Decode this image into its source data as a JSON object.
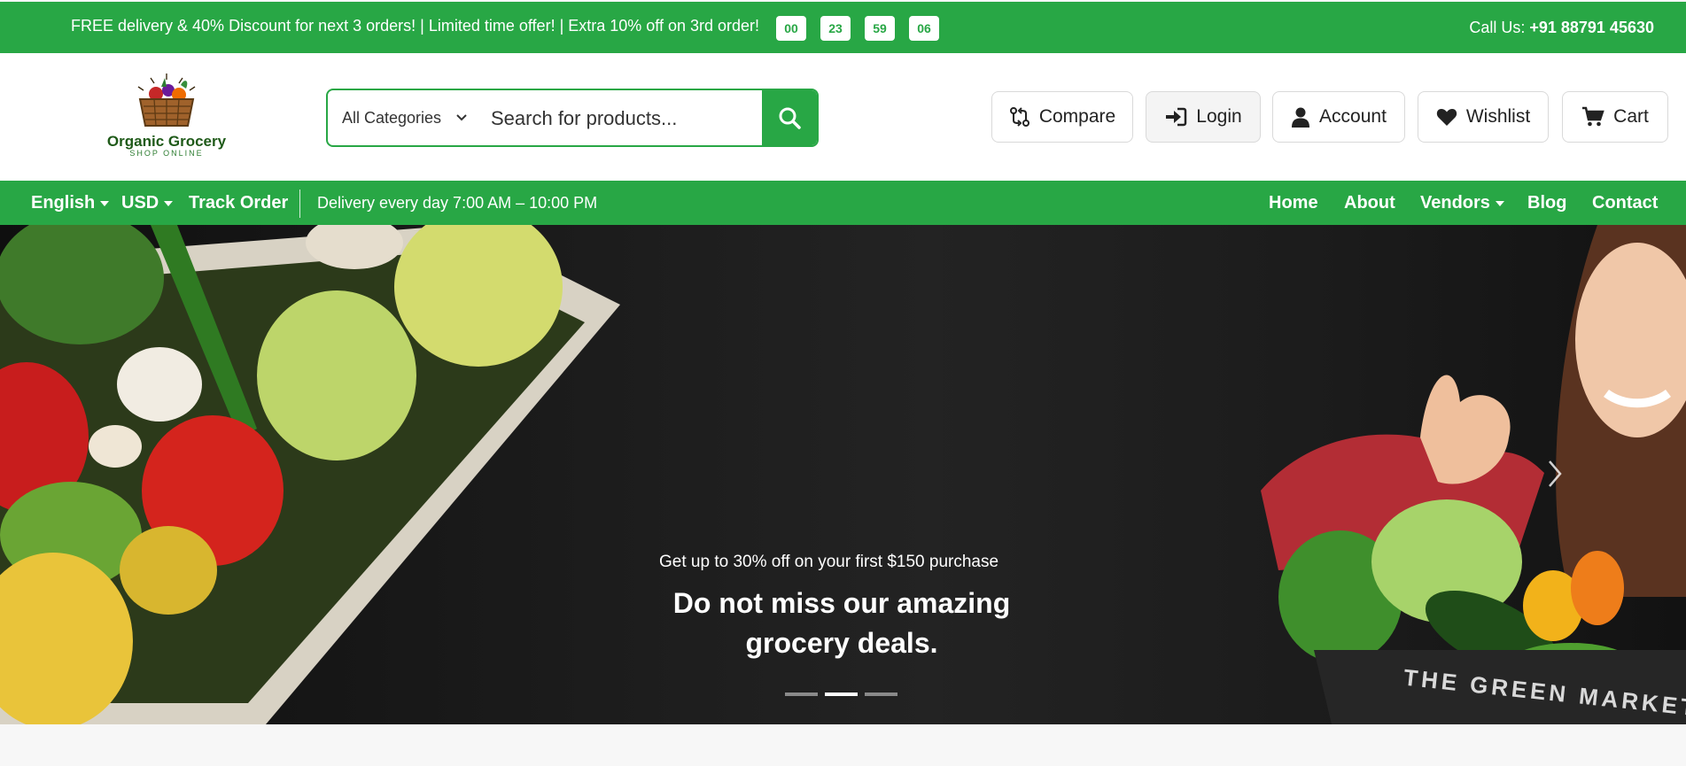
{
  "topbar": {
    "promo": "FREE delivery & 40% Discount for next 3 orders! | Limited time offer! | Extra 10% off on 3rd order!",
    "countdown": [
      "00",
      "23",
      "59",
      "06"
    ],
    "call_label": "Call Us: ",
    "call_number": "+91 88791 45630"
  },
  "header": {
    "logo_title": "Organic Grocery",
    "logo_subtitle": "SHOP ONLINE",
    "search": {
      "category": "All Categories",
      "placeholder": "Search for products..."
    },
    "buttons": {
      "compare": "Compare",
      "login": "Login",
      "account": "Account",
      "wishlist": "Wishlist",
      "cart": "Cart"
    }
  },
  "nav": {
    "language": "English",
    "currency": "USD",
    "track": "Track Order",
    "delivery": "Delivery every day 7:00 AM – 10:00 PM",
    "links": [
      "Home",
      "About",
      "Vendors",
      "Blog",
      "Contact"
    ]
  },
  "hero": {
    "subtitle": "Get up to 30% off on your first $150 purchase",
    "title": "Do not miss our amazing grocery deals.",
    "crate_text": "THE GREEN MARKET"
  },
  "colors": {
    "brand": "#28a745",
    "dark": "#1a1a1a"
  }
}
